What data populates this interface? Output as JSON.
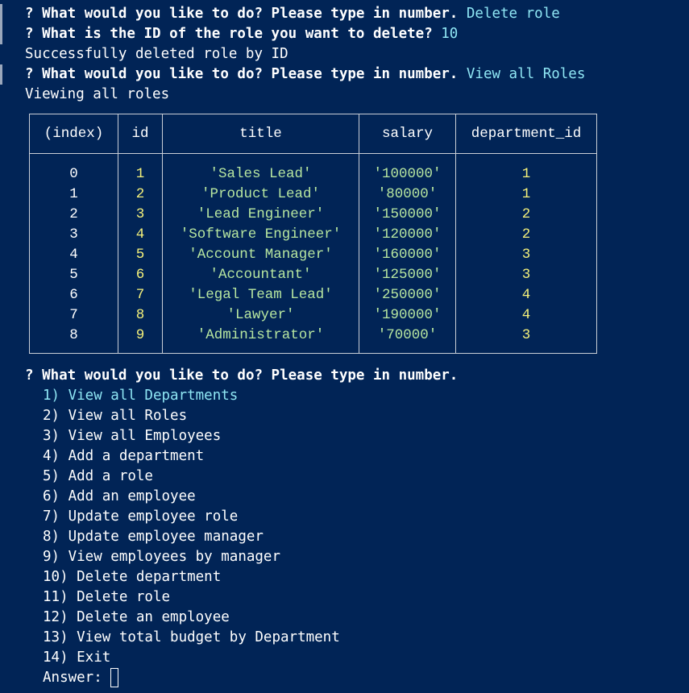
{
  "history": [
    {
      "prefix": "? ",
      "question": "What would you like to do? Please type in number. ",
      "answer": "Delete role"
    },
    {
      "prefix": "? ",
      "question": "What is the ID of the role you want to delete? ",
      "answer": "10"
    },
    {
      "text": "Successfully deleted role by ID"
    },
    {
      "prefix": "? ",
      "question": "What would you like to do? Please type in number. ",
      "answer": "View all Roles"
    },
    {
      "text": "Viewing all roles"
    }
  ],
  "table": {
    "headers": [
      "(index)",
      "id",
      "title",
      "salary",
      "department_id"
    ],
    "rows": [
      {
        "index": "0",
        "id": "1",
        "title": "'Sales Lead'",
        "salary": "'100000'",
        "department_id": "1"
      },
      {
        "index": "1",
        "id": "2",
        "title": "'Product Lead'",
        "salary": "'80000'",
        "department_id": "1"
      },
      {
        "index": "2",
        "id": "3",
        "title": "'Lead Engineer'",
        "salary": "'150000'",
        "department_id": "2"
      },
      {
        "index": "3",
        "id": "4",
        "title": "'Software Engineer'",
        "salary": "'120000'",
        "department_id": "2"
      },
      {
        "index": "4",
        "id": "5",
        "title": "'Account Manager'",
        "salary": "'160000'",
        "department_id": "3"
      },
      {
        "index": "5",
        "id": "6",
        "title": "'Accountant'",
        "salary": "'125000'",
        "department_id": "3"
      },
      {
        "index": "6",
        "id": "7",
        "title": "'Legal Team Lead'",
        "salary": "'250000'",
        "department_id": "4"
      },
      {
        "index": "7",
        "id": "8",
        "title": "'Lawyer'",
        "salary": "'190000'",
        "department_id": "4"
      },
      {
        "index": "8",
        "id": "9",
        "title": "'Administrator'",
        "salary": "'70000'",
        "department_id": "3"
      }
    ]
  },
  "prompt": {
    "prefix": "? ",
    "question": "What would you like to do? Please type in number."
  },
  "menu": [
    "1) View all Departments",
    "2) View all Roles",
    "3) View all Employees",
    "4) Add a department",
    "5) Add a role",
    "6) Add an employee",
    "7) Update employee role",
    "8) Update employee manager",
    "9) View employees by manager",
    "10) Delete department",
    "11) Delete role",
    "12) Delete an employee",
    "13) View total budget by Department",
    "14) Exit"
  ],
  "answer_label": "Answer: ",
  "colors": {
    "background": "#012456",
    "accent": "#8fe6f4",
    "number": "#f4f07a",
    "string": "#b7e6a0"
  }
}
